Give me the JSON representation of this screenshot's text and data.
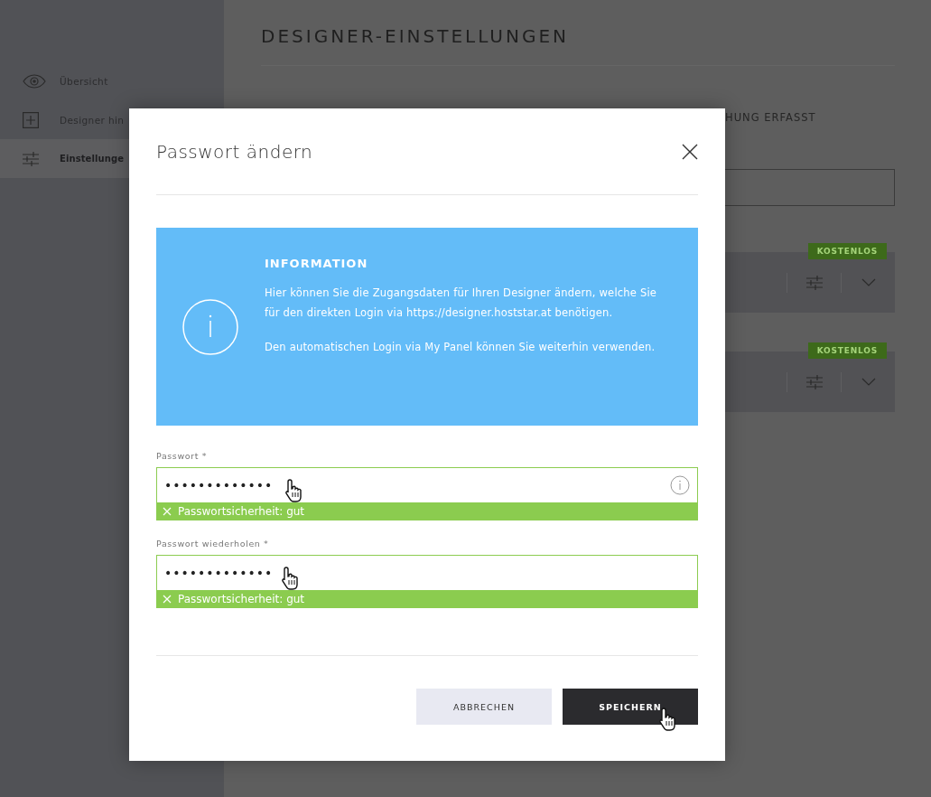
{
  "sidebar": {
    "items": [
      {
        "label": "Übersicht",
        "selected": false
      },
      {
        "label": "Designer hin",
        "selected": false
      },
      {
        "label": "Einstellunge",
        "selected": true
      }
    ]
  },
  "page": {
    "title": "DESIGNER-EINSTELLUNGEN",
    "partial_heading": "HUNG ERFASST",
    "cards": [
      {
        "badge": "KOSTENLOS"
      },
      {
        "badge": "KOSTENLOS"
      }
    ]
  },
  "dialog": {
    "title": "Passwort ändern",
    "info": {
      "heading": "INFORMATION",
      "paragraphs": [
        "Hier können Sie die Zugangsdaten für Ihren Designer ändern, welche Sie für den direkten Login via https://designer.hoststar.at benötigen.",
        "Den automatischen Login via My Panel können Sie weiterhin verwenden."
      ]
    },
    "fields": [
      {
        "label": "Passwort *",
        "value": "•••••••••••••",
        "strength": "Passwortsicherheit: gut",
        "info_icon": true
      },
      {
        "label": "Passwort wiederholen *",
        "value": "•••••••••••••",
        "strength": "Passwortsicherheit: gut",
        "info_icon": false
      }
    ],
    "buttons": [
      {
        "label": "ABBRECHEN",
        "kind": "secondary"
      },
      {
        "label": "SPEICHERN",
        "kind": "primary"
      }
    ]
  }
}
